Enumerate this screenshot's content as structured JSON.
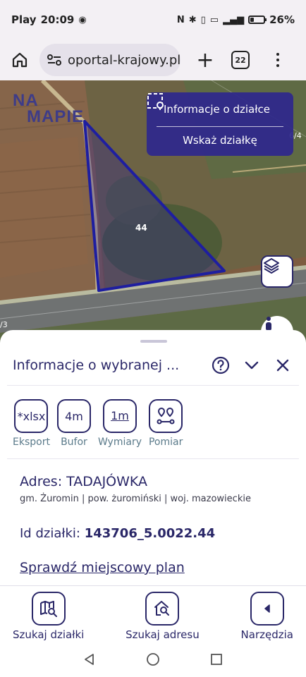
{
  "status_bar": {
    "carrier": "Play",
    "time": "20:09",
    "battery_text": "26%",
    "battery_level": 0.26
  },
  "browser": {
    "url": "oportal-krajowy.pl",
    "tab_count": "22"
  },
  "map": {
    "logo_line1": "NA",
    "logo_line2": "MAPIE",
    "parcel_panel": {
      "info_label": "Informacje o działce",
      "select_label": "Wskaż działkę"
    },
    "parcel_number_label": "44",
    "parcel_color": "#2a2290",
    "panel_color": "#2e288c"
  },
  "sheet": {
    "title": "Informacje o wybranej ...",
    "tools": [
      {
        "icon_text": "*xlsx",
        "label": "Eksport"
      },
      {
        "icon_text": "4m",
        "label": "Bufor"
      },
      {
        "icon_text": "1m",
        "label": "Wymiary"
      },
      {
        "icon_text": "",
        "label": "Pomiar"
      }
    ],
    "address": "Adres: TADAJÓWKA",
    "address_details": "gm. Żuromin | pow. żuromiński | woj. mazowieckie",
    "parcel_id_label": "Id działki:",
    "parcel_id_value": "143706_5.0022.44",
    "plan_link": "Sprawdź miejscowy plan"
  },
  "bottom_nav": [
    {
      "label": "Szukaj działki",
      "icon": "map-search-icon"
    },
    {
      "label": "Szukaj adresu",
      "icon": "home-search-icon"
    },
    {
      "label": "Narzędzia",
      "icon": "chevron-left-icon"
    }
  ],
  "colors": {
    "accent": "#2a2768",
    "tool_label": "#5a7a8a"
  }
}
